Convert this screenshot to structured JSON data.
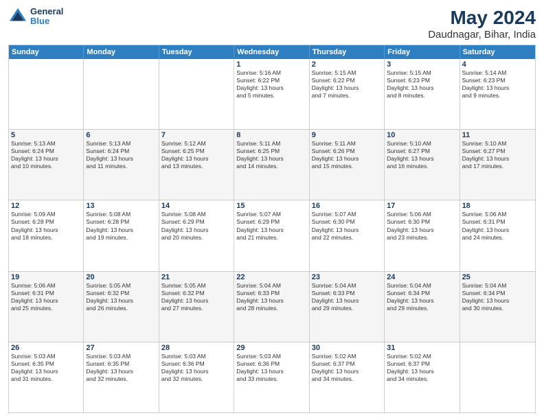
{
  "logo": {
    "line1": "General",
    "line2": "Blue"
  },
  "title": "May 2024",
  "subtitle": "Daudnagar, Bihar, India",
  "days": [
    "Sunday",
    "Monday",
    "Tuesday",
    "Wednesday",
    "Thursday",
    "Friday",
    "Saturday"
  ],
  "weeks": [
    [
      {
        "day": "",
        "info": []
      },
      {
        "day": "",
        "info": []
      },
      {
        "day": "",
        "info": []
      },
      {
        "day": "1",
        "info": [
          "Sunrise: 5:16 AM",
          "Sunset: 6:22 PM",
          "Daylight: 13 hours",
          "and 5 minutes."
        ]
      },
      {
        "day": "2",
        "info": [
          "Sunrise: 5:15 AM",
          "Sunset: 6:22 PM",
          "Daylight: 13 hours",
          "and 7 minutes."
        ]
      },
      {
        "day": "3",
        "info": [
          "Sunrise: 5:15 AM",
          "Sunset: 6:23 PM",
          "Daylight: 13 hours",
          "and 8 minutes."
        ]
      },
      {
        "day": "4",
        "info": [
          "Sunrise: 5:14 AM",
          "Sunset: 6:23 PM",
          "Daylight: 13 hours",
          "and 9 minutes."
        ]
      }
    ],
    [
      {
        "day": "5",
        "info": [
          "Sunrise: 5:13 AM",
          "Sunset: 6:24 PM",
          "Daylight: 13 hours",
          "and 10 minutes."
        ]
      },
      {
        "day": "6",
        "info": [
          "Sunrise: 5:13 AM",
          "Sunset: 6:24 PM",
          "Daylight: 13 hours",
          "and 11 minutes."
        ]
      },
      {
        "day": "7",
        "info": [
          "Sunrise: 5:12 AM",
          "Sunset: 6:25 PM",
          "Daylight: 13 hours",
          "and 13 minutes."
        ]
      },
      {
        "day": "8",
        "info": [
          "Sunrise: 5:11 AM",
          "Sunset: 6:25 PM",
          "Daylight: 13 hours",
          "and 14 minutes."
        ]
      },
      {
        "day": "9",
        "info": [
          "Sunrise: 5:11 AM",
          "Sunset: 6:26 PM",
          "Daylight: 13 hours",
          "and 15 minutes."
        ]
      },
      {
        "day": "10",
        "info": [
          "Sunrise: 5:10 AM",
          "Sunset: 6:27 PM",
          "Daylight: 13 hours",
          "and 16 minutes."
        ]
      },
      {
        "day": "11",
        "info": [
          "Sunrise: 5:10 AM",
          "Sunset: 6:27 PM",
          "Daylight: 13 hours",
          "and 17 minutes."
        ]
      }
    ],
    [
      {
        "day": "12",
        "info": [
          "Sunrise: 5:09 AM",
          "Sunset: 6:28 PM",
          "Daylight: 13 hours",
          "and 18 minutes."
        ]
      },
      {
        "day": "13",
        "info": [
          "Sunrise: 5:08 AM",
          "Sunset: 6:28 PM",
          "Daylight: 13 hours",
          "and 19 minutes."
        ]
      },
      {
        "day": "14",
        "info": [
          "Sunrise: 5:08 AM",
          "Sunset: 6:29 PM",
          "Daylight: 13 hours",
          "and 20 minutes."
        ]
      },
      {
        "day": "15",
        "info": [
          "Sunrise: 5:07 AM",
          "Sunset: 6:29 PM",
          "Daylight: 13 hours",
          "and 21 minutes."
        ]
      },
      {
        "day": "16",
        "info": [
          "Sunrise: 5:07 AM",
          "Sunset: 6:30 PM",
          "Daylight: 13 hours",
          "and 22 minutes."
        ]
      },
      {
        "day": "17",
        "info": [
          "Sunrise: 5:06 AM",
          "Sunset: 6:30 PM",
          "Daylight: 13 hours",
          "and 23 minutes."
        ]
      },
      {
        "day": "18",
        "info": [
          "Sunrise: 5:06 AM",
          "Sunset: 6:31 PM",
          "Daylight: 13 hours",
          "and 24 minutes."
        ]
      }
    ],
    [
      {
        "day": "19",
        "info": [
          "Sunrise: 5:06 AM",
          "Sunset: 6:31 PM",
          "Daylight: 13 hours",
          "and 25 minutes."
        ]
      },
      {
        "day": "20",
        "info": [
          "Sunrise: 5:05 AM",
          "Sunset: 6:32 PM",
          "Daylight: 13 hours",
          "and 26 minutes."
        ]
      },
      {
        "day": "21",
        "info": [
          "Sunrise: 5:05 AM",
          "Sunset: 6:32 PM",
          "Daylight: 13 hours",
          "and 27 minutes."
        ]
      },
      {
        "day": "22",
        "info": [
          "Sunrise: 5:04 AM",
          "Sunset: 6:33 PM",
          "Daylight: 13 hours",
          "and 28 minutes."
        ]
      },
      {
        "day": "23",
        "info": [
          "Sunrise: 5:04 AM",
          "Sunset: 6:33 PM",
          "Daylight: 13 hours",
          "and 29 minutes."
        ]
      },
      {
        "day": "24",
        "info": [
          "Sunrise: 5:04 AM",
          "Sunset: 6:34 PM",
          "Daylight: 13 hours",
          "and 29 minutes."
        ]
      },
      {
        "day": "25",
        "info": [
          "Sunrise: 5:04 AM",
          "Sunset: 6:34 PM",
          "Daylight: 13 hours",
          "and 30 minutes."
        ]
      }
    ],
    [
      {
        "day": "26",
        "info": [
          "Sunrise: 5:03 AM",
          "Sunset: 6:35 PM",
          "Daylight: 13 hours",
          "and 31 minutes."
        ]
      },
      {
        "day": "27",
        "info": [
          "Sunrise: 5:03 AM",
          "Sunset: 6:35 PM",
          "Daylight: 13 hours",
          "and 32 minutes."
        ]
      },
      {
        "day": "28",
        "info": [
          "Sunrise: 5:03 AM",
          "Sunset: 6:36 PM",
          "Daylight: 13 hours",
          "and 32 minutes."
        ]
      },
      {
        "day": "29",
        "info": [
          "Sunrise: 5:03 AM",
          "Sunset: 6:36 PM",
          "Daylight: 13 hours",
          "and 33 minutes."
        ]
      },
      {
        "day": "30",
        "info": [
          "Sunrise: 5:02 AM",
          "Sunset: 6:37 PM",
          "Daylight: 13 hours",
          "and 34 minutes."
        ]
      },
      {
        "day": "31",
        "info": [
          "Sunrise: 5:02 AM",
          "Sunset: 6:37 PM",
          "Daylight: 13 hours",
          "and 34 minutes."
        ]
      },
      {
        "day": "",
        "info": []
      }
    ]
  ]
}
